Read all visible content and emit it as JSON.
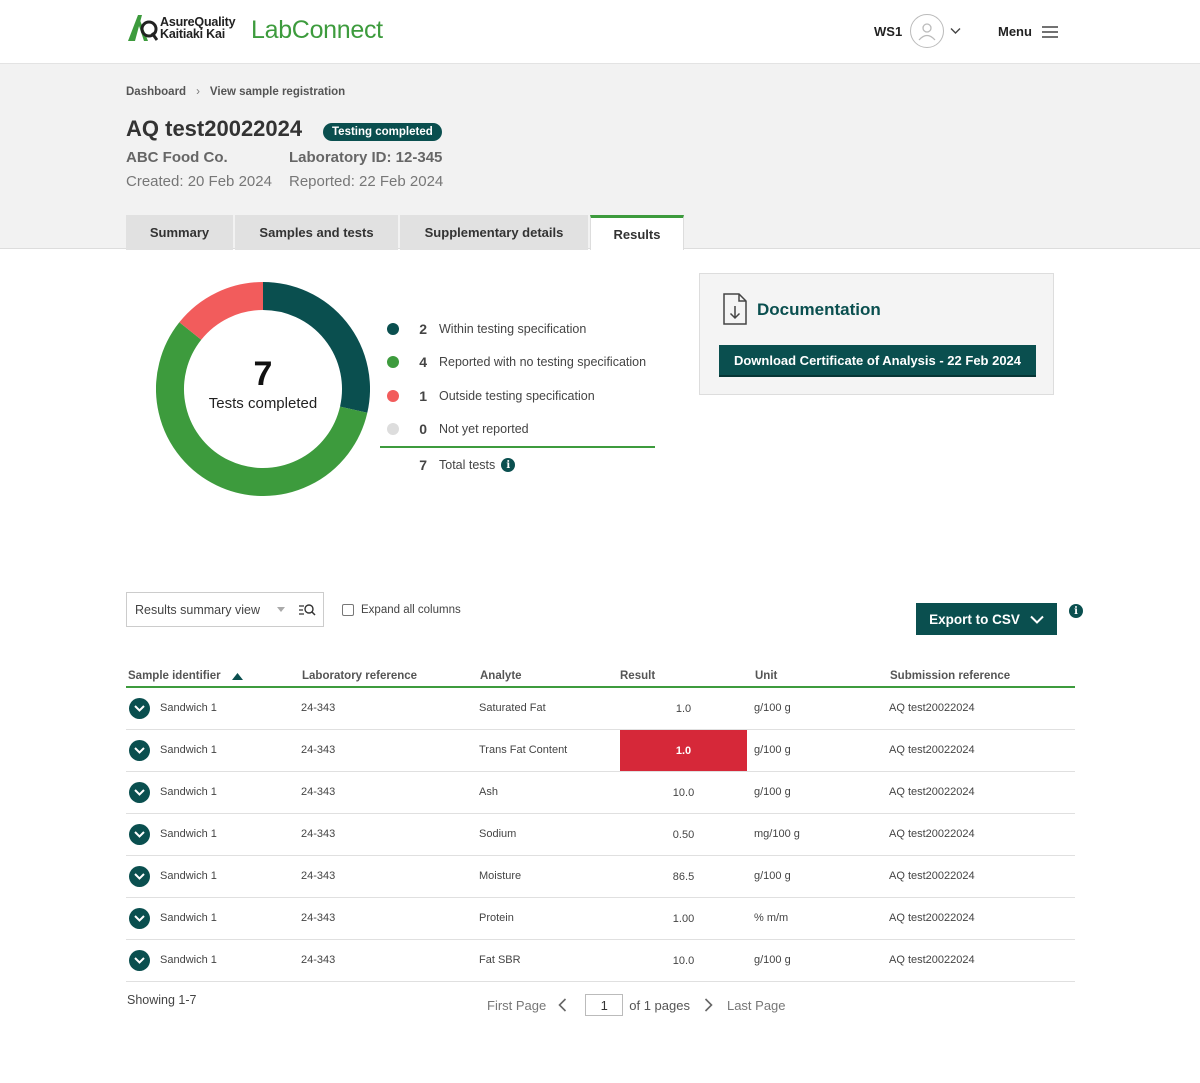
{
  "header": {
    "logo_line1": "AsureQuality",
    "logo_line2": "Kaitiaki Kai",
    "product": "LabConnect",
    "user": "WS1",
    "menu_label": "Menu"
  },
  "breadcrumb": [
    "Dashboard",
    "View sample registration"
  ],
  "registration": {
    "title": "AQ test20022024",
    "status": "Testing completed",
    "company": "ABC Food Co.",
    "lab_id": "Laboratory ID: 12-345",
    "created": "Created: 20 Feb 2024",
    "reported": "Reported: 22 Feb 2024"
  },
  "tabs": [
    {
      "label": "Summary"
    },
    {
      "label": "Samples and tests"
    },
    {
      "label": "Supplementary details"
    },
    {
      "label": "Results",
      "active": true
    }
  ],
  "summary": {
    "total": "7",
    "total_label": "Tests completed",
    "legend": [
      {
        "count": "2",
        "label": "Within testing specification",
        "color": "#0a4f4f"
      },
      {
        "count": "4",
        "label": "Reported with no testing specification",
        "color": "#3d9b3d"
      },
      {
        "count": "1",
        "label": "Outside testing specification",
        "color": "#f25c5c"
      },
      {
        "count": "0",
        "label": "Not yet reported",
        "color": "#dddddd"
      }
    ],
    "total_tests_count": "7",
    "total_tests_label": "Total tests"
  },
  "documentation": {
    "title": "Documentation",
    "download_label": "Download Certificate of Analysis - 22 Feb 2024"
  },
  "controls": {
    "view_selected": "Results summary view",
    "expand_label": "Expand all columns",
    "export_label": "Export to CSV"
  },
  "table": {
    "columns": [
      "Sample identifier",
      "Laboratory reference",
      "Analyte",
      "Result",
      "Unit",
      "Submission reference"
    ],
    "rows": [
      {
        "sample": "Sandwich 1",
        "lab_ref": "24-343",
        "analyte": "Saturated Fat",
        "result": "1.0",
        "unit": "g/100 g",
        "submission": "AQ test20022024",
        "outside": false
      },
      {
        "sample": "Sandwich 1",
        "lab_ref": "24-343",
        "analyte": "Trans Fat Content",
        "result": "1.0",
        "unit": "g/100 g",
        "submission": "AQ test20022024",
        "outside": true
      },
      {
        "sample": "Sandwich 1",
        "lab_ref": "24-343",
        "analyte": "Ash",
        "result": "10.0",
        "unit": "g/100 g",
        "submission": "AQ test20022024",
        "outside": false
      },
      {
        "sample": "Sandwich 1",
        "lab_ref": "24-343",
        "analyte": "Sodium",
        "result": "0.50",
        "unit": "mg/100 g",
        "submission": "AQ test20022024",
        "outside": false
      },
      {
        "sample": "Sandwich 1",
        "lab_ref": "24-343",
        "analyte": "Moisture",
        "result": "86.5",
        "unit": "g/100 g",
        "submission": "AQ test20022024",
        "outside": false
      },
      {
        "sample": "Sandwich 1",
        "lab_ref": "24-343",
        "analyte": "Protein",
        "result": "1.00",
        "unit": "% m/m",
        "submission": "AQ test20022024",
        "outside": false
      },
      {
        "sample": "Sandwich 1",
        "lab_ref": "24-343",
        "analyte": "Fat SBR",
        "result": "10.0",
        "unit": "g/100 g",
        "submission": "AQ test20022024",
        "outside": false
      }
    ]
  },
  "footer": {
    "showing": "Showing 1-7",
    "first_page": "First Page",
    "current_page": "1",
    "of_pages": "of 1 pages",
    "last_page": "Last Page"
  }
}
